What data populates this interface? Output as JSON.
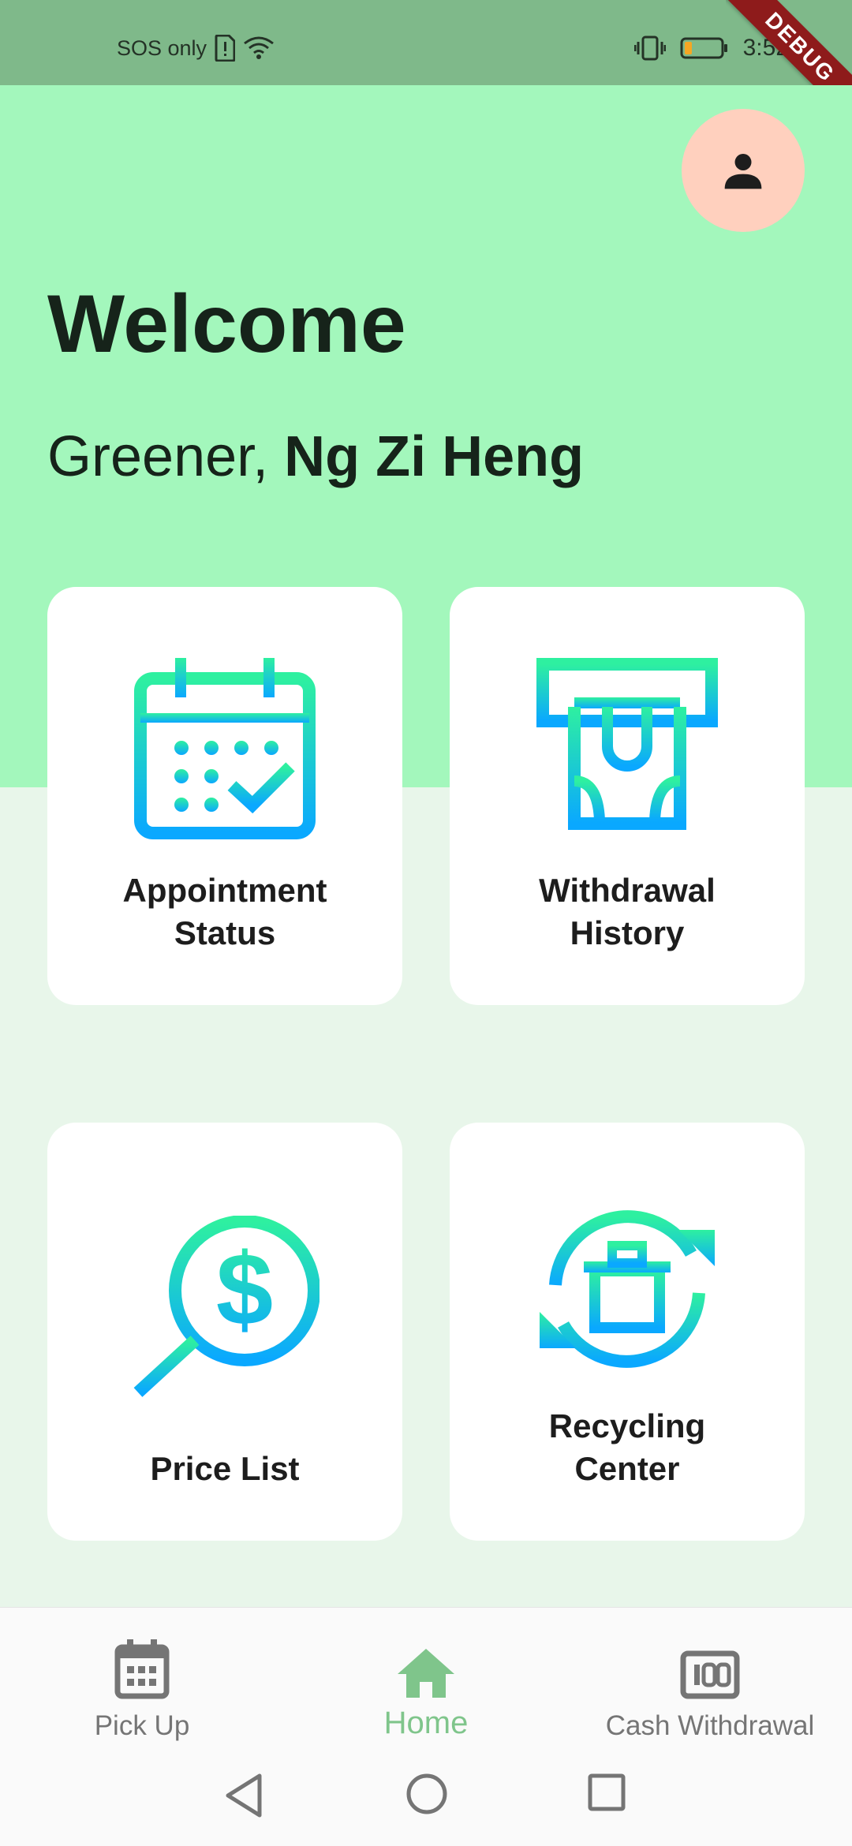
{
  "status_bar": {
    "carrier": "SOS only",
    "time": "3:52",
    "icons": [
      "sim-alert-icon",
      "wifi-icon",
      "vibrate-icon",
      "battery-icon"
    ],
    "battery_fill": 0.2
  },
  "debug_banner": "DEBUG",
  "header": {
    "title": "Welcome",
    "greeting_prefix": "Greener, ",
    "user_name": "Ng Zi Heng"
  },
  "cards": {
    "appointment": {
      "label": "Appointment\nStatus",
      "icon": "calendar-check-icon"
    },
    "withdrawal": {
      "label": "Withdrawal\nHistory",
      "icon": "atm-cash-icon"
    },
    "price": {
      "label": "Price List",
      "icon": "dollar-search-icon"
    },
    "recycling": {
      "label": "Recycling\nCenter",
      "icon": "recycle-bin-icon"
    }
  },
  "bottom_nav": {
    "items": [
      {
        "label": "Pick Up",
        "icon": "calendar-icon",
        "active": false
      },
      {
        "label": "Home",
        "icon": "home-icon",
        "active": true
      },
      {
        "label": "Cash Withdrawal",
        "icon": "money-icon",
        "active": false
      }
    ]
  },
  "colors": {
    "status_bar": "#7fb98a",
    "header_bg": "#a3f7bc",
    "page_bg": "#e8f6ea",
    "avatar_bg": "#ffd0be",
    "active_nav": "#7fc58b",
    "icon_gradient_top": "#2ef0a0",
    "icon_gradient_bottom": "#0aa8ff"
  }
}
